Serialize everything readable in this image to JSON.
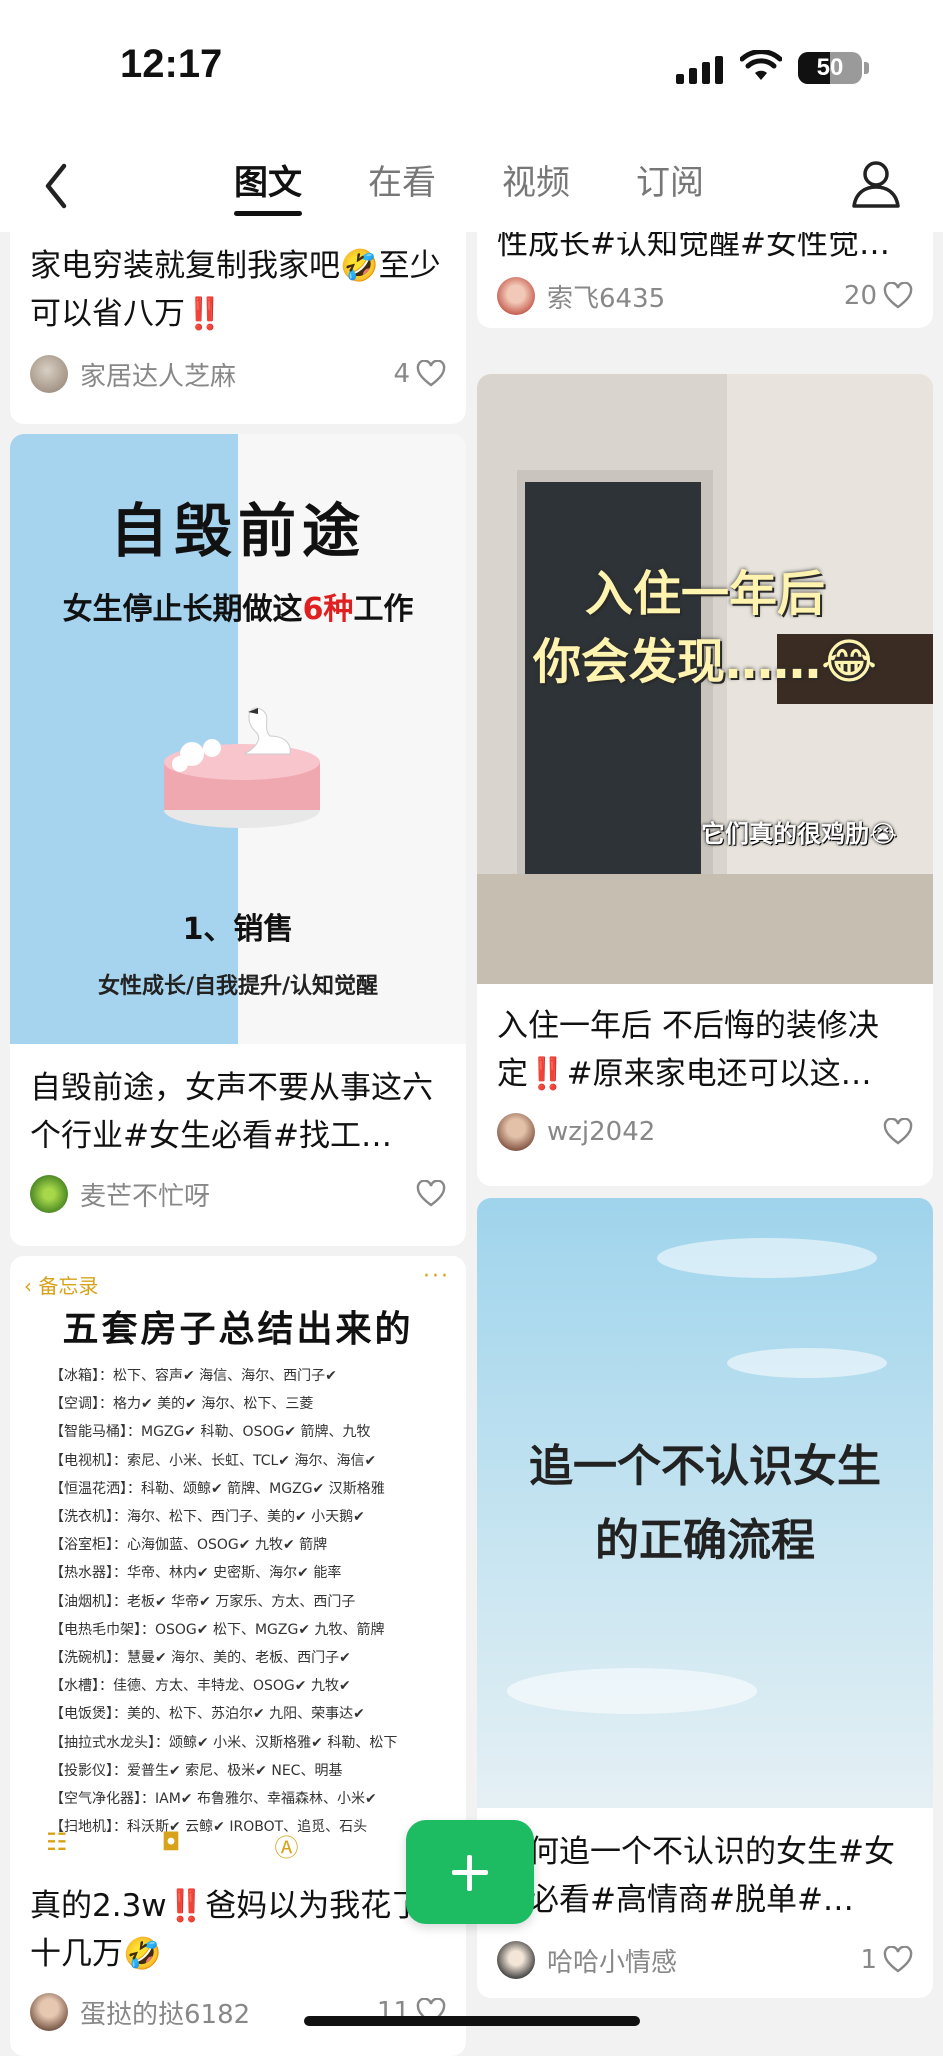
{
  "status_bar": {
    "time": "12:17",
    "battery": "50",
    "battery_level": 0.5
  },
  "nav": {
    "tabs": [
      {
        "label": "图文",
        "active": true
      },
      {
        "label": "在看",
        "active": false
      },
      {
        "label": "视频",
        "active": false
      },
      {
        "label": "订阅",
        "active": false
      }
    ],
    "back_icon": "chevron-left-icon",
    "profile_icon": "user-icon"
  },
  "cards": {
    "c1": {
      "title": "家电穷装就复制我家吧🤣至少可以省八万",
      "title_suffix": "‼️",
      "author": "家居达人芝麻",
      "likes": "4"
    },
    "c2": {
      "title": "性成长#认知觉醒#女性觉…",
      "author": "索飞6435",
      "likes": "20"
    },
    "c3": {
      "image": {
        "line1": "自毁前途",
        "line2a": "女生停止长期做这",
        "line2b": "6种",
        "line2c": "工作",
        "line3": "1、销售",
        "line4": "女性成长/自我提升/认知觉醒"
      },
      "title": "自毁前途，女声不要从事这六个行业#女生必看#找工…",
      "author": "麦芒不忙呀",
      "likes": ""
    },
    "c4": {
      "image": {
        "line1": "入住一年后",
        "line2": "你会发现……😂",
        "line3": "它们真的很鸡肋😭"
      },
      "title_a": "入住一年后 不后悔的装修决定",
      "title_b": "‼️",
      "title_c": "#原来家电还可以这…",
      "author": "wzj2042",
      "likes": ""
    },
    "c5": {
      "image": {
        "back": "备忘录",
        "more": "···",
        "heading": "五套房子总结出来的",
        "rows": [
          "【冰箱】：松下、容声✔ 海信、海尔、西门子✔",
          "【空调】：格力✔ 美的✔ 海尔、松下、三菱",
          "【智能马桶】：MGZG✔ 科勒、OSOG✔ 箭牌、九牧",
          "【电视机】：索尼、小米、长虹、TCL✔ 海尔、海信✔",
          "【恒温花洒】：科勒、颂鲸✔ 箭牌、MGZG✔ 汉斯格雅",
          "【洗衣机】：海尔、松下、西门子、美的✔ 小天鹅✔",
          "【浴室柜】：心海伽蓝、OSOG✔ 九牧✔ 箭牌",
          "【热水器】：华帝、林内✔ 史密斯、海尔✔ 能率",
          "【油烟机】：老板✔ 华帝✔ 万家乐、方太、西门子",
          "【电热毛巾架】：OSOG✔ 松下、MGZG✔ 九牧、箭牌",
          "【洗碗机】：慧曼✔ 海尔、美的、老板、西门子✔",
          "【水槽】：佳德、方太、丰特龙、OSOG✔ 九牧✔",
          "【电饭煲】：美的、松下、苏泊尔✔ 九阳、荣事达✔",
          "【抽拉式水龙头】：颂鲸✔ 小米、汉斯格雅✔ 科勒、松下",
          "【投影仪】：爱普生✔ 索尼、极米✔ NEC、明基",
          "【空气净化器】：IAM✔ 布鲁雅尔、幸福森林、小米✔",
          "【扫地机】：科沃斯✔ 云鲸✔ IROBOT、追觅、石头"
        ]
      },
      "title_a": "真的2.3w",
      "title_b": "‼️",
      "title_c": "爸妈以为我花了十几万🤣",
      "author": "蛋挞的挞6182",
      "likes": "11"
    },
    "c6": {
      "image": {
        "line1": "追一个不认识女生",
        "line2": "的正确流程"
      },
      "title": "如何追一个不认识的女生#女生必看#高情商#脱单#…",
      "author": "哈哈小情感",
      "likes": "1"
    }
  },
  "fab": {
    "icon": "plus-icon",
    "color": "#1dbb62"
  }
}
